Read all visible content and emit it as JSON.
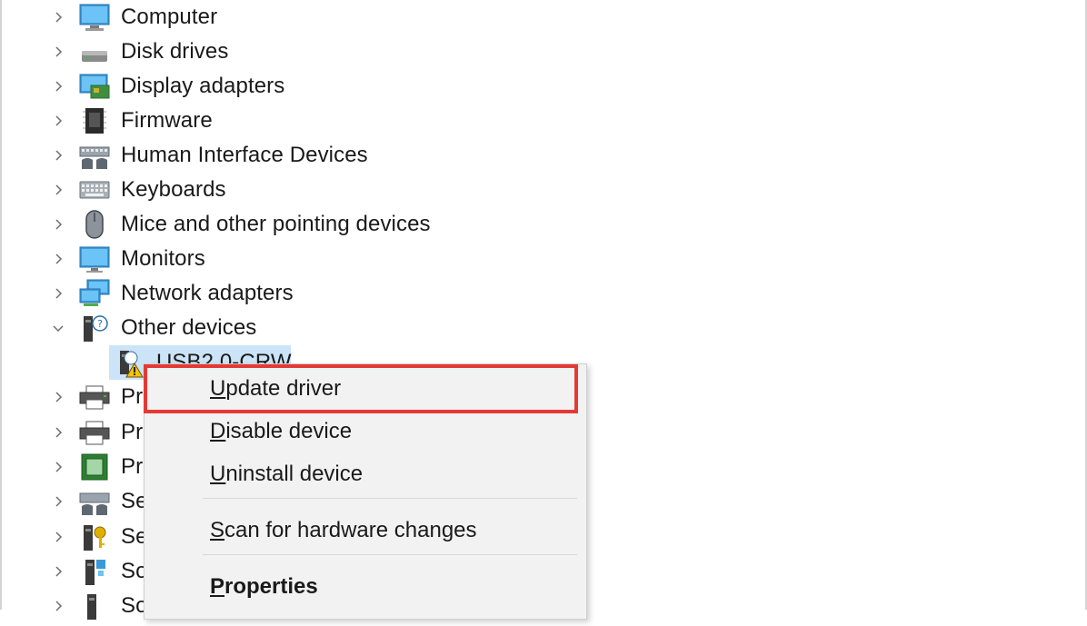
{
  "device_tree": {
    "categories": [
      {
        "label": "Computer",
        "icon": "computer-icon",
        "state": "collapsed"
      },
      {
        "label": "Disk drives",
        "icon": "disk-drive-icon",
        "state": "collapsed"
      },
      {
        "label": "Display adapters",
        "icon": "display-adapter-icon",
        "state": "collapsed"
      },
      {
        "label": "Firmware",
        "icon": "firmware-chip-icon",
        "state": "collapsed"
      },
      {
        "label": "Human Interface Devices",
        "icon": "hid-icon",
        "state": "collapsed"
      },
      {
        "label": "Keyboards",
        "icon": "keyboard-icon",
        "state": "collapsed"
      },
      {
        "label": "Mice and other pointing devices",
        "icon": "mouse-icon",
        "state": "collapsed"
      },
      {
        "label": "Monitors",
        "icon": "monitor-icon",
        "state": "collapsed"
      },
      {
        "label": "Network adapters",
        "icon": "network-adapter-icon",
        "state": "collapsed"
      },
      {
        "label": "Other devices",
        "icon": "unknown-device-icon",
        "state": "expanded"
      },
      {
        "label": "Pr",
        "icon": "printer-icon",
        "state": "collapsed"
      },
      {
        "label": "Pr",
        "icon": "printer-icon",
        "state": "collapsed"
      },
      {
        "label": "Pr",
        "icon": "processor-icon",
        "state": "collapsed"
      },
      {
        "label": "Se",
        "icon": "sensor-icon",
        "state": "collapsed"
      },
      {
        "label": "Se",
        "icon": "security-device-icon",
        "state": "collapsed"
      },
      {
        "label": "So",
        "icon": "software-component-icon",
        "state": "collapsed"
      },
      {
        "label": "So",
        "icon": "software-device-icon",
        "state": "collapsed"
      }
    ],
    "selected_child": {
      "label": "USB2.0-CRW",
      "icon": "warning-device-icon"
    }
  },
  "context_menu": {
    "items": [
      {
        "label": "Update driver",
        "accel": "U",
        "rest": "pdate driver"
      },
      {
        "label": "Disable device",
        "accel": "D",
        "rest": "isable device"
      },
      {
        "label": "Uninstall device",
        "accel": "U",
        "rest": "ninstall device"
      },
      {
        "label": "Scan for hardware changes",
        "accel": "S",
        "rest": "can for hardware changes"
      },
      {
        "label": "Properties",
        "accel": "P",
        "rest": "roperties"
      }
    ]
  },
  "highlight": {
    "color": "#e53935",
    "target": "Update driver"
  },
  "colors": {
    "selection": "#cce4f7",
    "menu_bg": "#f2f2f2",
    "accent_blue": "#2b88d8"
  }
}
